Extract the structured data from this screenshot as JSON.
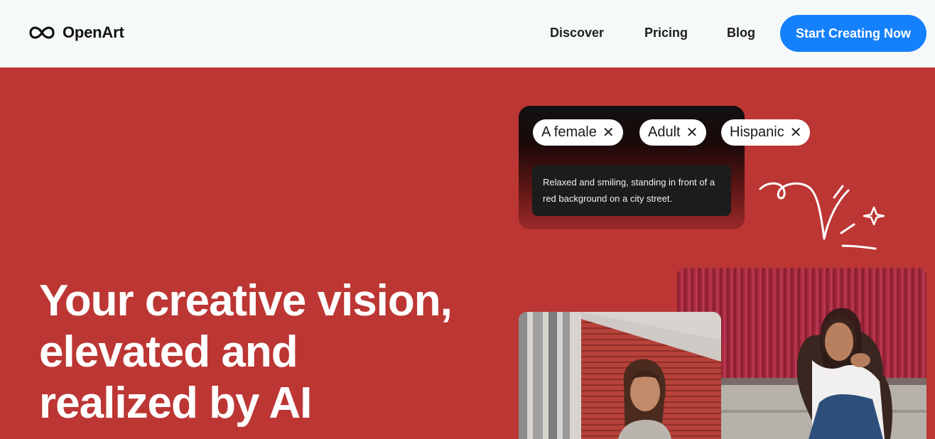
{
  "header": {
    "brand": "OpenArt",
    "nav": [
      "Discover",
      "Pricing",
      "Blog"
    ],
    "cta_label": "Start Creating Now"
  },
  "hero": {
    "title_lines": [
      "Your creative vision,",
      "elevated and",
      "realized by AI"
    ]
  },
  "prompt_card": {
    "tags": [
      "A female",
      "Adult",
      "Hispanic"
    ],
    "prompt": "Relaxed and smiling, standing in front of a red background on a city street."
  },
  "colors": {
    "hero_bg": "#bc3634",
    "header_bg": "#f6f9f9",
    "accent": "#1580fb"
  },
  "icons": {
    "logo": "infinity-icon",
    "tag_remove": "close-icon",
    "doodle": "sparkle-doodle"
  }
}
